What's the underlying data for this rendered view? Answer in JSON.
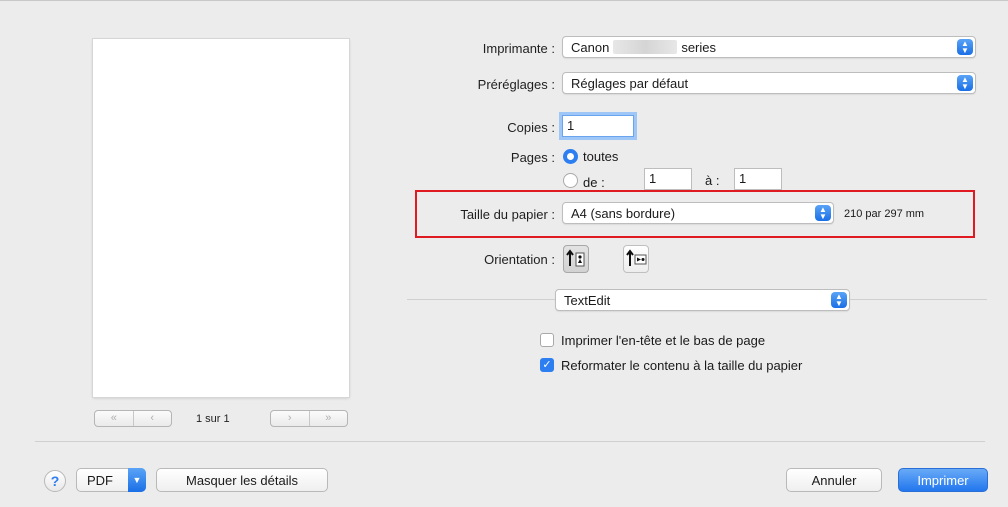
{
  "preview": {
    "prev_label": "«  ‹",
    "next_label": "›  »",
    "page_indicator": "1 sur 1"
  },
  "printer": {
    "label": "Imprimante :",
    "name_prefix": "Canon",
    "name_suffix": "series"
  },
  "presets": {
    "label": "Préréglages :",
    "value": "Réglages par défaut"
  },
  "copies": {
    "label": "Copies :",
    "value": "1"
  },
  "pages": {
    "label": "Pages :",
    "all_label": "toutes",
    "range_label": "de :",
    "from": "1",
    "to_label": "à :",
    "to": "1"
  },
  "paper_size": {
    "label": "Taille du papier :",
    "value": "A4 (sans bordure)",
    "dimensions": "210 par 297 mm"
  },
  "orientation": {
    "label": "Orientation :"
  },
  "app_section": {
    "value": "TextEdit"
  },
  "options": {
    "header_footer": "Imprimer l'en-tête et le bas de page",
    "header_footer_checked": false,
    "rewrap": "Reformater le contenu à la taille du papier",
    "rewrap_checked": true
  },
  "footer": {
    "help": "?",
    "pdf": "PDF",
    "hide_details": "Masquer les détails",
    "cancel": "Annuler",
    "print": "Imprimer"
  },
  "colors": {
    "accent": "#2d7ef0",
    "highlight": "#e01a21"
  },
  "icons": {
    "popup": "up-down-chevron",
    "portrait": "portrait-orientation",
    "landscape": "landscape-orientation",
    "checkmark": "check"
  }
}
